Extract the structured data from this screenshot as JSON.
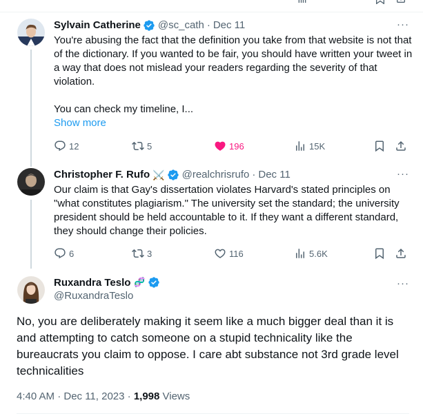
{
  "tweets": [
    {
      "name": "Sylvain Catherine",
      "handle": "@sc_cath",
      "date": "Dec 11",
      "text": "You're abusing the fact that the definition you take from that website is not that of the dictionary. If you wanted to be fair, you should have written your tweet in a way that does not mislead your readers regarding the severity of that violation.\n\nYou can check my timeline, I...",
      "show_more": "Show more",
      "replies": "12",
      "reposts": "5",
      "likes": "196",
      "views": "15K"
    },
    {
      "name": "Christopher F. Rufo",
      "name_emoji": "⚔️",
      "handle": "@realchrisrufo",
      "date": "Dec 11",
      "text": "Our claim is that Gay's dissertation violates Harvard's stated principles on \"what constitutes plagiarism.\" The university set the standard; the university president should be held accountable to it. If they want a different standard, they should change their policies.",
      "replies": "6",
      "reposts": "3",
      "likes": "116",
      "views": "5.6K"
    }
  ],
  "main": {
    "name": "Ruxandra Teslo",
    "name_emoji": "🧬",
    "handle": "@RuxandraTeslo",
    "text": "No, you are deliberately making it seem like a much bigger deal than it is and attempting to catch someone on a stupid technicality like the bureaucrats you claim to oppose. I care abt substance not 3rd grade level technicalities",
    "time": "4:40 AM · Dec 11, 2023 · ",
    "views_count": "1,998",
    "views_label": " Views"
  },
  "ui": {
    "more_glyph": "···",
    "dot": "·"
  },
  "colors": {
    "verified": "#1d9bf0",
    "like": "#f91880",
    "secondary": "#536471"
  }
}
